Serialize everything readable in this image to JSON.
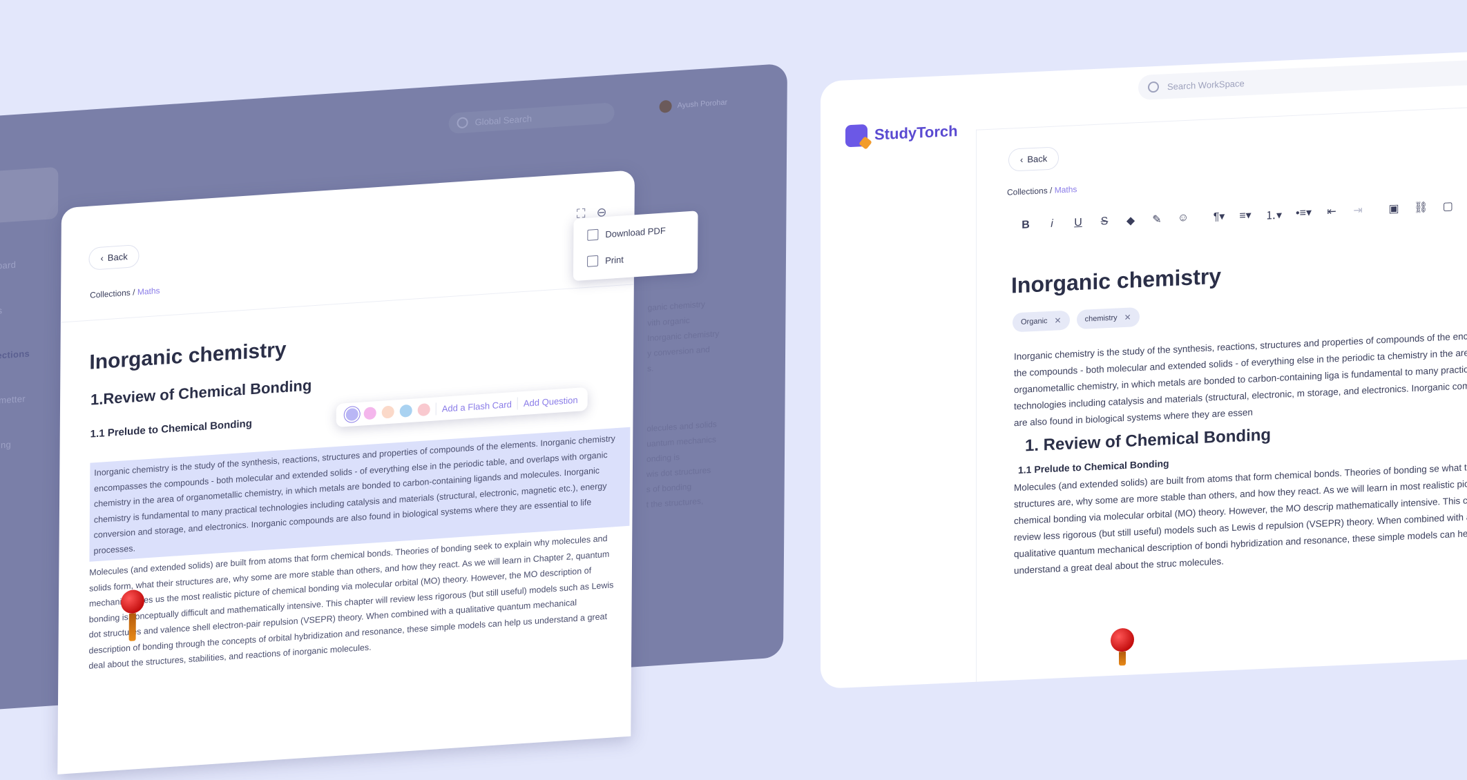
{
  "left": {
    "search_placeholder": "Global Search",
    "user_name": "Ayush Porohar",
    "nav": [
      "board",
      "rts",
      "llections",
      "mmetter",
      "ming"
    ],
    "back_label": "Back",
    "breadcrumb": {
      "root": "Collections",
      "sep": "/",
      "current": "Maths"
    },
    "title": "Inorganic chemistry",
    "heading": "1.Review of Chemical Bonding",
    "subheading": "1.1 Prelude to Chemical Bonding",
    "para_selected": "Inorganic chemistry is the study of the synthesis, reactions, structures and properties of compounds of the elements. Inorganic chemistry encompasses the compounds - both molecular and extended solids - of everything else in the periodic table, and overlaps with organic chemistry in the area of organometallic chemistry, in which metals are bonded to carbon-containing ligands and molecules. Inorganic chemistry is fundamental to many practical technologies including catalysis and materials (structural, electronic, magnetic etc.), energy conversion and storage, and electronics. Inorganic compounds are also found in biological systems where they are essential to life processes.",
    "para_2": "Molecules (and extended solids) are built from atoms that form chemical bonds. Theories of bonding seek to explain why molecules and solids form, what their structures are, why some are more stable than others, and how they react. As we will learn in Chapter 2, quantum mechanics gives us the most realistic picture of chemical bonding via molecular orbital (MO) theory. However, the MO description of bonding is conceptually difficult and mathematically intensive. This chapter will review less rigorous (but still useful) models such as Lewis dot structures and valence shell electron-pair repulsion (VSEPR) theory. When combined with a qualitative quantum mechanical description of bonding through the concepts of orbital hybridization and resonance, these simple models can help us understand a great deal about the structures, stabilities, and reactions of inorganic molecules.",
    "bg_text_1": [
      "ganic chemistry",
      "vith organic",
      "Inorganic chemistry",
      "y conversion and",
      "s."
    ],
    "bg_text_2": [
      "olecules and solids",
      "uantum mechanics",
      "onding is",
      "wis dot structures",
      "s of bonding",
      "t the structures,"
    ],
    "float_toolbar": {
      "colors": [
        "#b9b6f5",
        "#f4b6ec",
        "#fbd9c9",
        "#a9d2f1",
        "#f9c9cf"
      ],
      "flash_card": "Add a Flash Card",
      "add_question": "Add Question"
    },
    "menu": {
      "download": "Download PDF",
      "print": "Print"
    }
  },
  "right": {
    "brand": "StudyTorch",
    "search_placeholder": "Search WorkSpace",
    "back_label": "Back",
    "breadcrumb": {
      "root": "Collections",
      "sep": "/",
      "current": "Maths"
    },
    "toolbar": {
      "bold": "B",
      "italic": "i",
      "underline": "U",
      "strike": "S",
      "color": "◆",
      "highlight": "✎",
      "emoji": "☺",
      "paragraph": "¶▾",
      "align": "≡▾",
      "olist": "⒈▾",
      "ulist": "•≡▾",
      "outdent": "⇤",
      "indent": "⇥",
      "image": "▣",
      "link": "⛓",
      "file": "▢"
    },
    "title": "Inorganic chemistry",
    "tags": [
      "Organic",
      "chemistry"
    ],
    "para_1": "Inorganic chemistry is the study of the synthesis, reactions, structures and properties of compounds of the encompasses the compounds - both molecular and extended solids - of everything else in the periodic ta chemistry in the area of organometallic chemistry, in which metals are bonded to carbon-containing liga is fundamental to many practical technologies including catalysis and materials (structural, electronic, m storage, and electronics. Inorganic compounds are also found in biological systems where they are essen",
    "heading": "1. Review of Chemical Bonding",
    "subheading": "1.1 Prelude to Chemical Bonding",
    "para_2": "Molecules (and extended solids) are built from atoms that form chemical bonds. Theories of bonding se what their structures are, why some are more stable than others, and how they react. As we will learn in most realistic picture of chemical bonding via molecular orbital (MO) theory. However, the MO descrip mathematically intensive. This chapter will review less rigorous (but still useful) models such as Lewis d repulsion (VSEPR) theory. When combined with a qualitative quantum mechanical description of bondi hybridization and resonance, these simple models can help us understand a great deal about the struc molecules."
  }
}
